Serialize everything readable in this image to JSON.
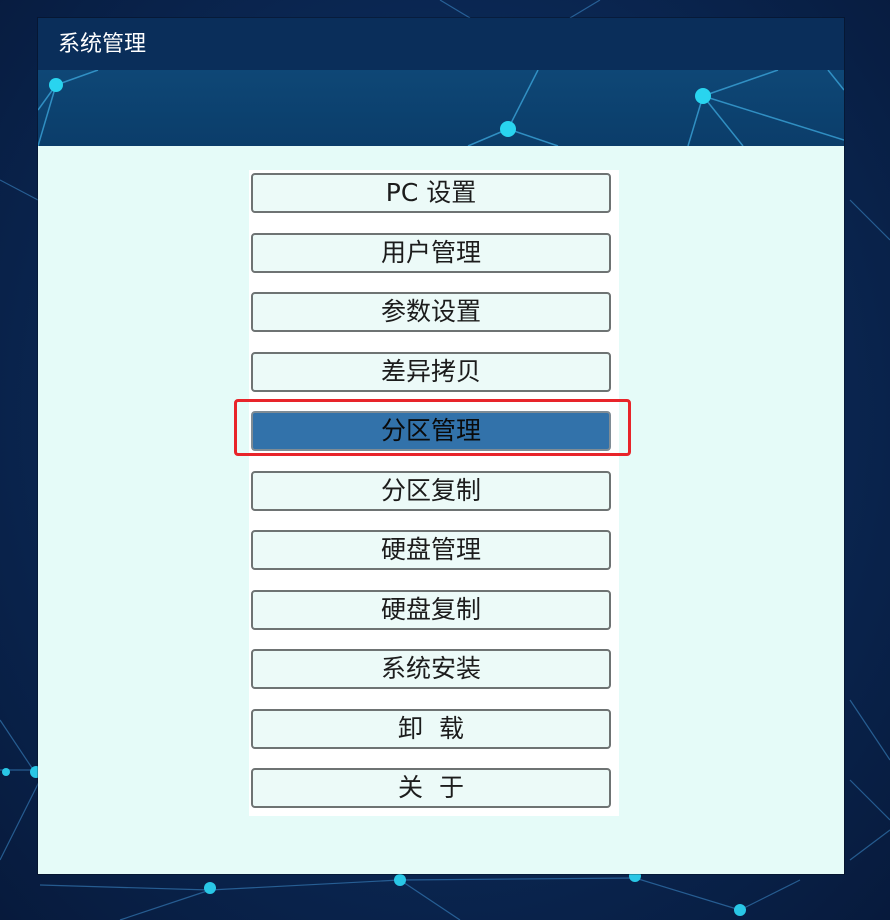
{
  "window": {
    "title": "系统管理"
  },
  "menu": {
    "selected_index": 4,
    "items": [
      {
        "label": "PC 设置",
        "name": "pc-settings-button"
      },
      {
        "label": "用户管理",
        "name": "user-management-button"
      },
      {
        "label": "参数设置",
        "name": "parameter-settings-button"
      },
      {
        "label": "差异拷贝",
        "name": "differential-copy-button"
      },
      {
        "label": "分区管理",
        "name": "partition-management-button"
      },
      {
        "label": "分区复制",
        "name": "partition-copy-button"
      },
      {
        "label": "硬盘管理",
        "name": "disk-management-button"
      },
      {
        "label": "硬盘复制",
        "name": "disk-copy-button"
      },
      {
        "label": "系统安装",
        "name": "system-install-button"
      },
      {
        "label": "卸  载",
        "name": "uninstall-button"
      },
      {
        "label": "关  于",
        "name": "about-button"
      }
    ]
  },
  "colors": {
    "selected_fill": "#3272aa",
    "highlight_outline": "#e8242a",
    "panel_background": "#e5fbf8",
    "title_bar": "#0a2e5a"
  }
}
